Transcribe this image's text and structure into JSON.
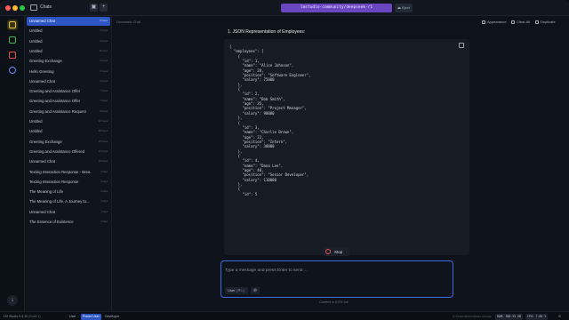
{
  "titlebar": {
    "section_label": "Chats",
    "model_name": "lmstudio-community/deepseek-r1",
    "eject_label": "Eject"
  },
  "rail": {
    "icons": [
      "chat-icon",
      "terminal-icon",
      "folder-icon",
      "search-icon"
    ],
    "colors": [
      "#e6c84a",
      "#3fb950",
      "#e5534b",
      "#6f8cf5"
    ],
    "bottom_icon": "download-icon"
  },
  "sidebar": {
    "chats": [
      {
        "title": "Unnamed Chat",
        "date": "6 hours",
        "active": true
      },
      {
        "title": "Untitled",
        "date": "6 hours"
      },
      {
        "title": "Untitled",
        "date": "6 hours"
      },
      {
        "title": "Untitled",
        "date": "40 mins"
      },
      {
        "title": "Greeting Exchange",
        "date": "6 hours"
      },
      {
        "title": "Hello Greeting",
        "date": "6 hours"
      },
      {
        "title": "Unnamed Chat",
        "date": "6 hours"
      },
      {
        "title": "Greeting and Assistance Offer",
        "date": "7 hours"
      },
      {
        "title": "Greeting and Assistance Offer",
        "date": "7 hours"
      },
      {
        "title": "Greeting and Assistance Request",
        "date": "8 hours"
      },
      {
        "title": "Untitled",
        "date": "10 hours"
      },
      {
        "title": "Untitled",
        "date": "48 hours"
      },
      {
        "title": "Greeting Exchange",
        "date": "15 hours"
      },
      {
        "title": "Greeting and Assistance Offered",
        "date": "15 hours"
      },
      {
        "title": "Unnamed Chat",
        "date": "26 hours"
      },
      {
        "title": "Texting Interaction Response - Brea...",
        "date": "2 days"
      },
      {
        "title": "Texting Interaction Response",
        "date": "2 days"
      },
      {
        "title": "The Meaning of Life",
        "date": "2 days"
      },
      {
        "title": "The Meaning of Life, A Journey to...",
        "date": "2 days"
      },
      {
        "title": "Unnamed Chat",
        "date": "2 days"
      },
      {
        "title": "The Essence of Existence",
        "date": "2 days"
      }
    ]
  },
  "main": {
    "title": "Unnamed Chat",
    "actions": [
      "Appearance",
      "Clear All",
      "Duplicate"
    ],
    "heading": "1. JSON Representation of Employees:",
    "code_lines": [
      "{",
      "  \"employees\": [",
      "    {",
      "      \"id\": 1,",
      "      \"name\": \"Alice Johnson\",",
      "      \"age\": 28,",
      "      \"position\": \"Software Engineer\",",
      "      \"salary\": 75000",
      "    },",
      "    {",
      "      \"id\": 2,",
      "      \"name\": \"Bob Smith\",",
      "      \"age\": 35,",
      "      \"position\": \"Project Manager\",",
      "      \"salary\": 90000",
      "    },",
      "    {",
      "      \"id\": 3,",
      "      \"name\": \"Charlie Brown\",",
      "      \"age\": 22,",
      "      \"position\": \"Intern\",",
      "      \"salary\": 30000",
      "    },",
      "    {",
      "      \"id\": 4,",
      "      \"name\": \"Dana Lee\",",
      "      \"age\": 40,",
      "      \"position\": \"Senior Developer\",",
      "      \"salary\": 110000",
      "    },",
      "    {",
      "      \"id\": 5"
    ],
    "stop_label": "Stop",
    "composer": {
      "placeholder": "Type a message and press Enter to send ...",
      "role_label": "User",
      "role_shortcut": "(⌘U)"
    },
    "context_text": "Context is 0.0% full"
  },
  "statusbar": {
    "app_name": "LM Studio 0.3.10",
    "build": "(Build 1)",
    "modes": [
      "User",
      "Power User",
      "Developer"
    ],
    "active_mode": "Power User",
    "system_label": "SYSTEM RESOURCES USAGE:",
    "ram": "RAM: 368.35 GB",
    "cpu": "CPU: 7.00 %"
  }
}
